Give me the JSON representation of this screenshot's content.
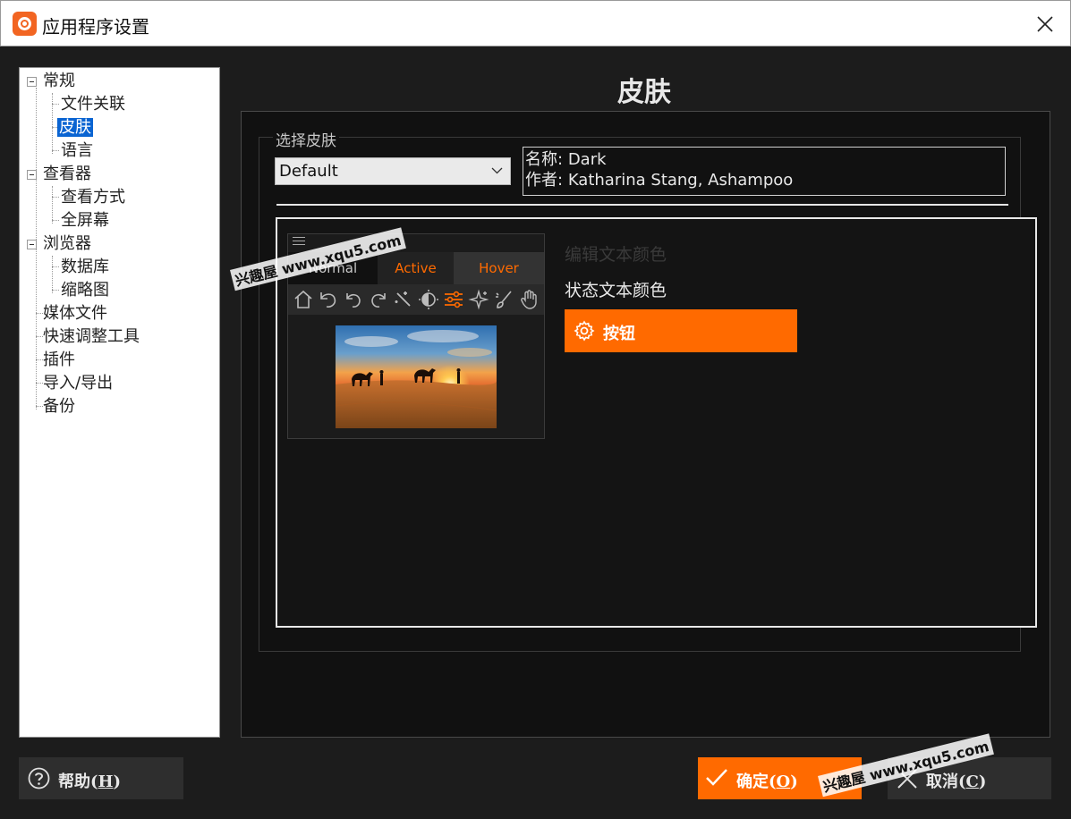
{
  "window": {
    "title": "应用程序设置"
  },
  "tree": {
    "items": [
      {
        "label": "常规"
      },
      {
        "label": "文件关联"
      },
      {
        "label": "皮肤"
      },
      {
        "label": "语言"
      },
      {
        "label": "查看器"
      },
      {
        "label": "查看方式"
      },
      {
        "label": "全屏幕"
      },
      {
        "label": "浏览器"
      },
      {
        "label": "数据库"
      },
      {
        "label": "缩略图"
      },
      {
        "label": "媒体文件"
      },
      {
        "label": "快速调整工具"
      },
      {
        "label": "插件"
      },
      {
        "label": "导入/导出"
      },
      {
        "label": "备份"
      }
    ],
    "selected": "皮肤"
  },
  "page": {
    "title": "皮肤",
    "group_label": "选择皮肤",
    "skin_select": {
      "value": "Default"
    },
    "info": {
      "name_label": "名称:",
      "name_value": "Dark",
      "author_label": "作者:",
      "author_value": "Katharina Stang, Ashampoo"
    },
    "preview": {
      "tabs": [
        "Normal",
        "Active",
        "Hover"
      ],
      "toolbar_icons": [
        "home-icon",
        "undo-back-icon",
        "undo-icon",
        "redo-icon",
        "magic-wand-icon",
        "contrast-icon",
        "sliders-icon",
        "sparkle-icon",
        "brush-icon",
        "hand-icon"
      ],
      "edit_text_color": "编辑文本颜色",
      "status_text_color": "状态文本颜色",
      "button_label": "按钮"
    }
  },
  "footer": {
    "help": {
      "text": "帮助(",
      "key": "H",
      "tail": ")"
    },
    "ok": {
      "text": "确定(",
      "key": "O",
      "tail": ")"
    },
    "cancel": {
      "text": "取消(",
      "key": "C",
      "tail": ")"
    }
  },
  "watermarks": [
    "兴趣屋 www.xqu5.com",
    "兴趣屋 www.xqu5.com"
  ],
  "colors": {
    "accent": "#ff6a00",
    "selection": "#0a64d2",
    "background": "#1c1c1c"
  }
}
